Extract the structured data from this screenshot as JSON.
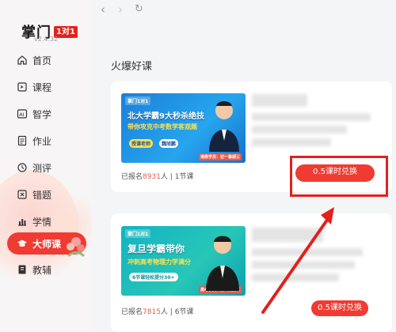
{
  "app": {
    "logo_text": "掌门",
    "logo_badge": "1对1",
    "version": "v2.4.32"
  },
  "sidebar": {
    "items": [
      {
        "label": "首页",
        "icon": "home-icon"
      },
      {
        "label": "课程",
        "icon": "course-icon"
      },
      {
        "label": "智学",
        "icon": "ai-icon"
      },
      {
        "label": "作业",
        "icon": "homework-icon"
      },
      {
        "label": "测评",
        "icon": "test-icon"
      },
      {
        "label": "错题",
        "icon": "wrong-question-icon"
      },
      {
        "label": "学情",
        "icon": "chart-icon"
      },
      {
        "label": "大师课",
        "icon": "graduation-cap-icon",
        "active": true
      },
      {
        "label": "教辅",
        "icon": "book-icon"
      }
    ]
  },
  "topbar": {
    "back": "‹",
    "forward": "›",
    "refresh": "↻"
  },
  "main": {
    "section_title": "火爆好课",
    "cards": [
      {
        "thumb_badge": "掌门1对1",
        "thumb_title_1": "北大学霸9大秒杀绝技",
        "thumb_title_2": "带你攻克中考数学客观题",
        "thumb_tag_1": "授课老师",
        "thumb_tag_2": "魏旭鹏",
        "thumb_tag_3": "道教学员：初一暑期三",
        "enrolled_prefix": "已报名",
        "enrolled_count": "8931",
        "enrolled_suffix": "人",
        "lessons_sep": " | ",
        "lessons": "1节课",
        "button_label": "0.5课时兑换"
      },
      {
        "thumb_badge": "掌门1对1",
        "thumb_title_1": "复旦学霸带你",
        "thumb_title_2": "冲刺高考物理力学满分",
        "thumb_tag_1": "6节课轻松提分30+",
        "thumb_tag_2": "高考学员：高一到高三",
        "enrolled_prefix": "已报名",
        "enrolled_count": "7815",
        "enrolled_suffix": "人",
        "lessons_sep": " | ",
        "lessons": "6节课",
        "button_label": "0.5课时兑换"
      }
    ]
  },
  "colors": {
    "accent": "#f03b32",
    "highlight": "#e3201b"
  }
}
